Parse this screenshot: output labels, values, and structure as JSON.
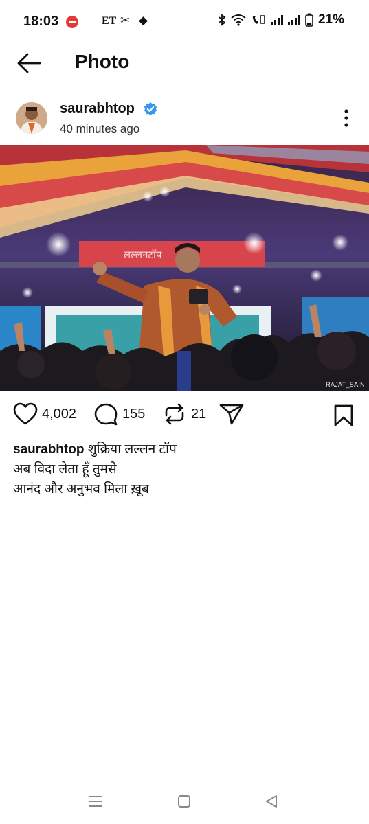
{
  "status_bar": {
    "time": "18:03",
    "carrier_badge": "ET",
    "battery_percent": "21%",
    "signal_level": 0.75,
    "battery_level": 0.21,
    "icons": [
      "do-not-disturb-icon",
      "scissors-icon",
      "tag-icon",
      "bluetooth-icon",
      "wifi-icon",
      "wifi-calling-icon",
      "signal-bars-icon",
      "battery-icon"
    ]
  },
  "top_bar": {
    "title": "Photo",
    "back_icon": "arrow-left-icon"
  },
  "post": {
    "username": "saurabhtop",
    "verified": true,
    "time_ago": "40 minutes ago",
    "more_icon": "more-vertical-icon",
    "image_watermark": "RAJAT_SAIN"
  },
  "actions": {
    "likes": "4,002",
    "comments": "155",
    "reposts": "21"
  },
  "caption": {
    "username": "saurabhtop",
    "line1": "शुक्रिया लल्लन टॉप",
    "line2": "अब विदा लेता हूँ तुमसे",
    "line3": "आनंद और अनुभव मिला ख़ूब"
  },
  "colors": {
    "verified_blue": "#3897f0",
    "text": "#111111",
    "background": "#ffffff"
  }
}
